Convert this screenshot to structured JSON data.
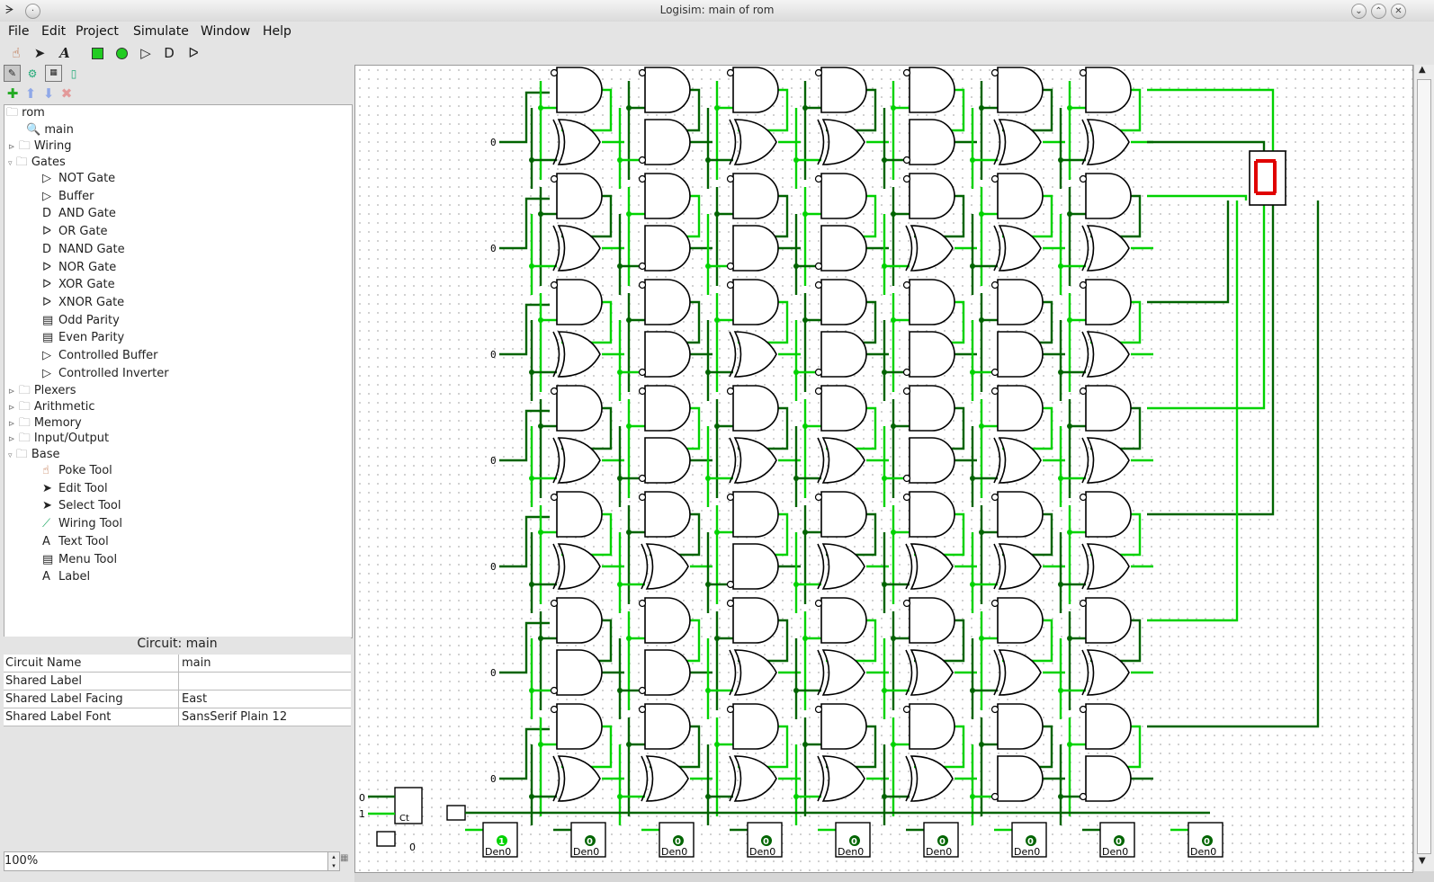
{
  "window": {
    "title": "Logisim: main of rom"
  },
  "menus": [
    "File",
    "Edit",
    "Project",
    "Simulate",
    "Window",
    "Help"
  ],
  "toolbar": {
    "tools": [
      "poke-tool-icon",
      "edit-tool-icon",
      "text-tool-icon",
      "input-pin-icon",
      "output-pin-icon",
      "not-gate-icon",
      "and-gate-icon",
      "or-gate-icon"
    ],
    "explorer": [
      "toolbox-view-icon",
      "simulation-view-icon",
      "layout-view-icon",
      "appearance-view-icon"
    ],
    "project_actions": [
      "add-circuit-icon",
      "move-up-icon",
      "move-down-icon",
      "delete-circuit-icon"
    ]
  },
  "tree": {
    "project": "rom",
    "circuit": "main",
    "folders": {
      "wiring": "Wiring",
      "gates": "Gates",
      "plexers": "Plexers",
      "arithmetic": "Arithmetic",
      "memory": "Memory",
      "io": "Input/Output",
      "base": "Base"
    },
    "gates": [
      "NOT Gate",
      "Buffer",
      "AND Gate",
      "OR Gate",
      "NAND Gate",
      "NOR Gate",
      "XOR Gate",
      "XNOR Gate",
      "Odd Parity",
      "Even Parity",
      "Controlled Buffer",
      "Controlled Inverter"
    ],
    "base": [
      "Poke Tool",
      "Edit Tool",
      "Select Tool",
      "Wiring Tool",
      "Text Tool",
      "Menu Tool",
      "Label"
    ]
  },
  "properties": {
    "title": "Circuit: main",
    "rows": [
      {
        "key": "Circuit Name",
        "value": "main"
      },
      {
        "key": "Shared Label",
        "value": ""
      },
      {
        "key": "Shared Label Facing",
        "value": "East"
      },
      {
        "key": "Shared Label Font",
        "value": "SansSerif Plain 12"
      }
    ]
  },
  "zoom": "100%",
  "circuit": {
    "row_inputs": [
      "0",
      "0",
      "0",
      "0",
      "0",
      "0",
      "0"
    ],
    "counter_inputs": [
      "0",
      "1"
    ],
    "counter_label": "Ct",
    "counter_out": "0",
    "register_values": [
      "1",
      "0",
      "0",
      "0",
      "0",
      "0",
      "0",
      "0",
      "0"
    ],
    "register_label": "Den0",
    "colors": {
      "wire_high": "#00d200",
      "wire_low": "#006400",
      "segment_on": "#e00000"
    }
  }
}
